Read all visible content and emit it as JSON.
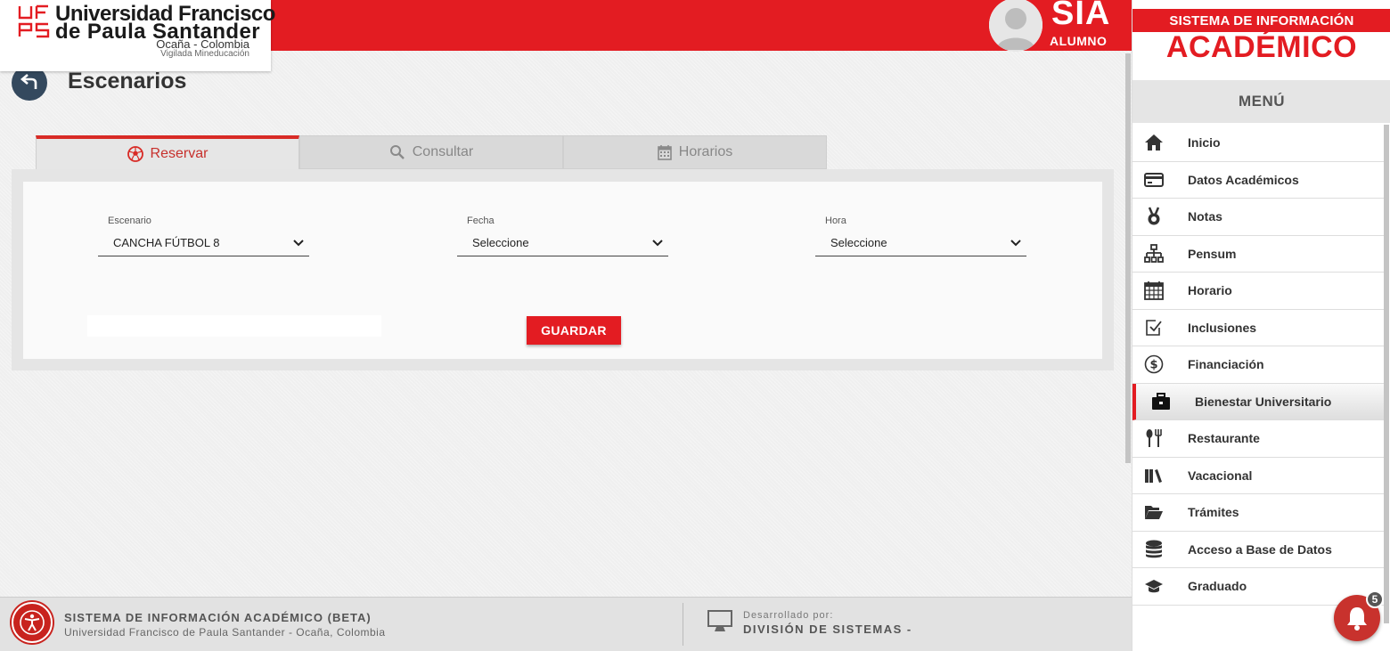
{
  "header": {
    "university_line1": "Universidad Francisco",
    "university_line2": "de Paula Santander",
    "city": "Ocaña - Colombia",
    "vigilada": "Vigilada Mineducación",
    "app_title": "SIA",
    "app_subtitle": "ALUMNO"
  },
  "page": {
    "title": "Escenarios"
  },
  "tabs": [
    {
      "label": "Reservar",
      "icon": "soccer-ball-icon",
      "active": true
    },
    {
      "label": "Consultar",
      "icon": "search-icon",
      "active": false
    },
    {
      "label": "Horarios",
      "icon": "calendar-icon",
      "active": false
    }
  ],
  "form": {
    "escenario": {
      "label": "Escenario",
      "value": "CANCHA FÚTBOL 8"
    },
    "fecha": {
      "label": "Fecha",
      "value": "Seleccione"
    },
    "hora": {
      "label": "Hora",
      "value": "Seleccione"
    },
    "save_label": "GUARDAR"
  },
  "footer": {
    "title": "SISTEMA DE INFORMACIÓN ACADÉMICO (BETA)",
    "subtitle": "Universidad Francisco de Paula Santander - Ocaña, Colombia",
    "dev_label": "Desarrollado por:",
    "dev_name": "DIVISIÓN DE SISTEMAS -"
  },
  "sidebar": {
    "header": "SISTEMA DE INFORMACIÓN",
    "brand": "ACADÉMICO",
    "menu_title": "MENÚ",
    "items": [
      {
        "label": "Inicio",
        "icon": "home-icon"
      },
      {
        "label": "Datos Académicos",
        "icon": "credit-card-icon"
      },
      {
        "label": "Notas",
        "icon": "medal-icon"
      },
      {
        "label": "Pensum",
        "icon": "sitemap-icon"
      },
      {
        "label": "Horario",
        "icon": "calendar-grid-icon"
      },
      {
        "label": "Inclusiones",
        "icon": "checkbox-icon"
      },
      {
        "label": "Financiación",
        "icon": "dollar-circle-icon"
      },
      {
        "label": "Bienestar Universitario",
        "icon": "briefcase-icon",
        "active": true
      },
      {
        "label": "Restaurante",
        "icon": "utensils-icon"
      },
      {
        "label": "Vacacional",
        "icon": "books-icon"
      },
      {
        "label": "Trámites",
        "icon": "folder-open-icon"
      },
      {
        "label": "Acceso a Base de Datos",
        "icon": "database-icon"
      },
      {
        "label": "Graduado",
        "icon": "graduation-cap-icon"
      }
    ]
  },
  "notifications": {
    "count": "5"
  },
  "colors": {
    "accent": "#e31c22",
    "dark": "#34495e"
  }
}
